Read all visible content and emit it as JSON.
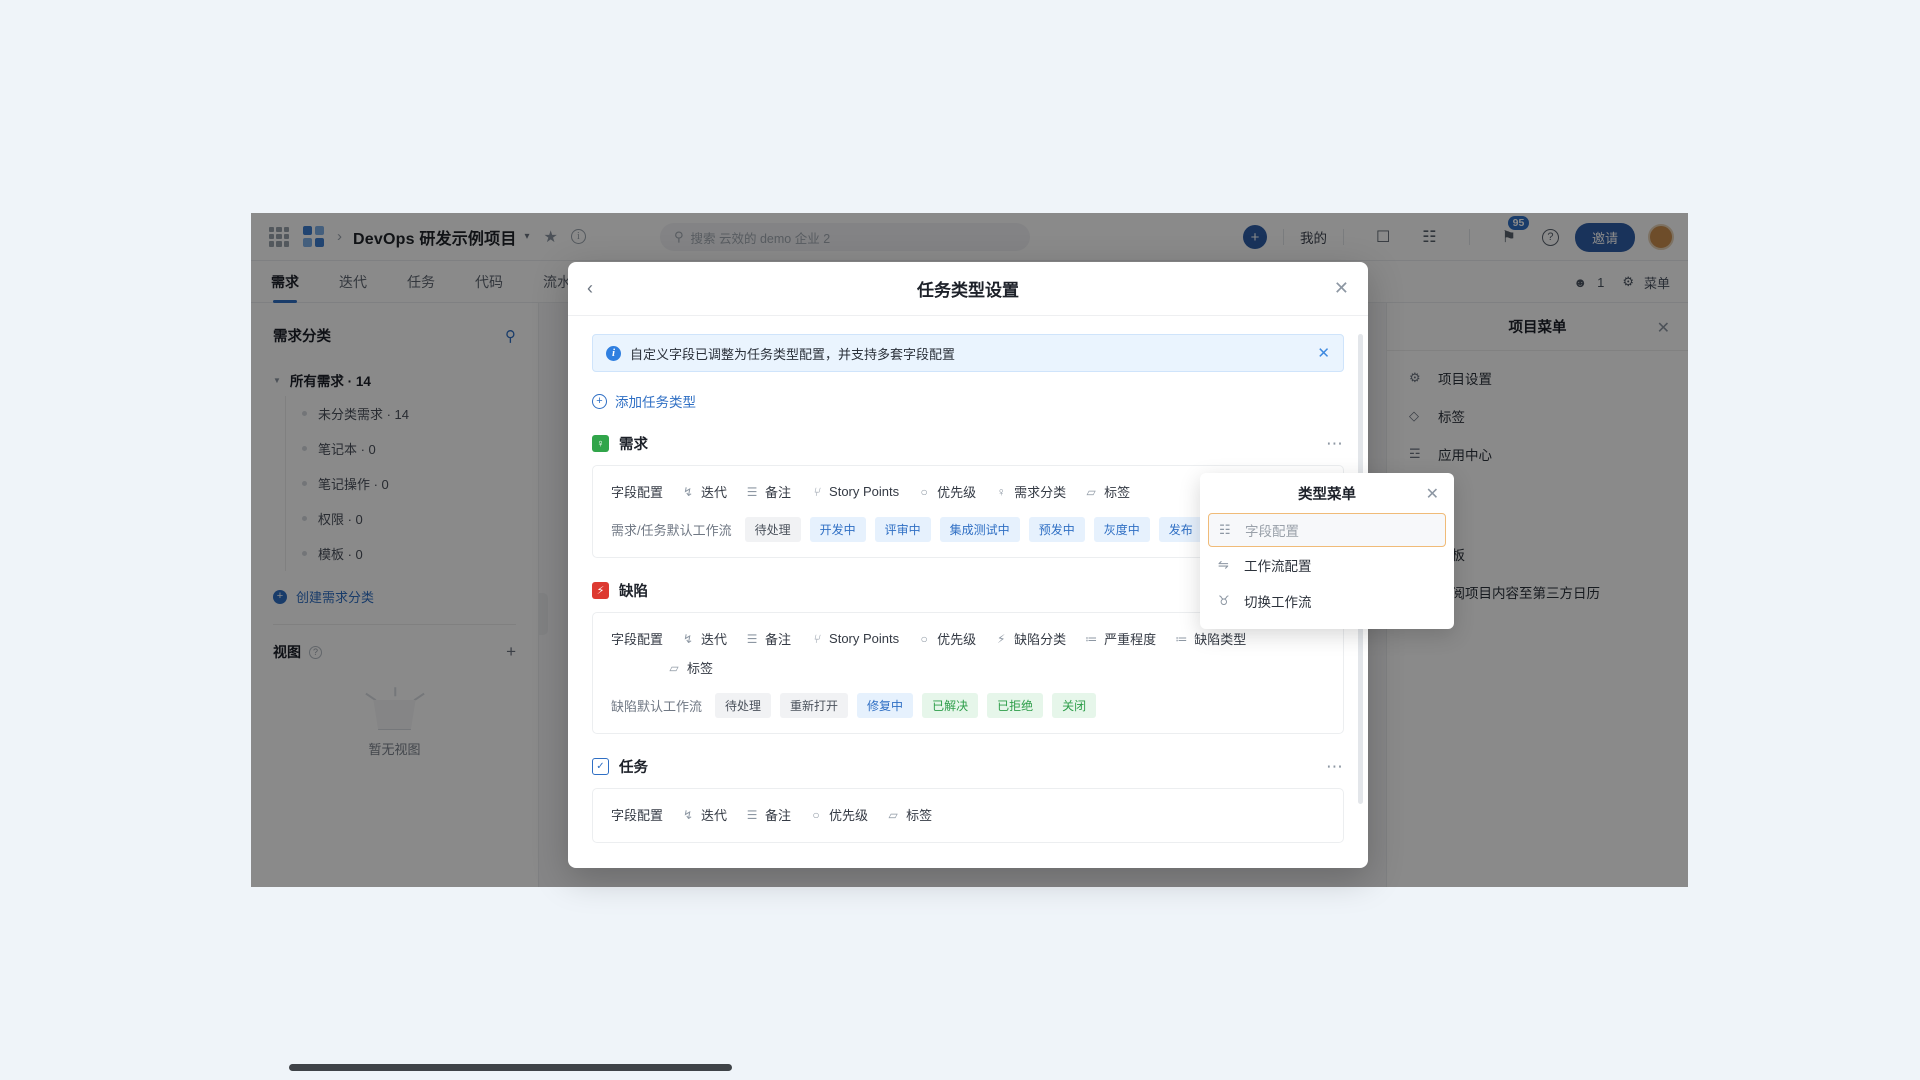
{
  "topbar": {
    "apps_icon": "grid-apps-icon",
    "workspace_icon": "workspace-logo-icon",
    "breadcrumb_sep": "›",
    "project_name": "DevOps 研发示例项目",
    "caret": "▾",
    "star_icon": "★",
    "info_icon": "i",
    "search_placeholder": "搜索 云效的 demo 企业 2",
    "search_icon": "⚲",
    "plus_label": "+",
    "mine_label": "我的",
    "calendar_icon": "☐",
    "message_icon": "☷",
    "bell_icon": "⚑",
    "bell_badge": "95",
    "help_icon": "?",
    "invite_label": "邀请",
    "avatar": "user-avatar"
  },
  "nav": {
    "tabs": [
      {
        "label": "需求",
        "active": true
      },
      {
        "label": "迭代",
        "active": false
      },
      {
        "label": "任务",
        "active": false
      },
      {
        "label": "代码",
        "active": false
      },
      {
        "label": "流水",
        "active": false
      }
    ],
    "member_icon": "☻",
    "member_count": "1",
    "menu_icon": "⚙",
    "menu_label": "菜单"
  },
  "left_sidebar": {
    "title": "需求分类",
    "search_icon": "search-icon",
    "root": {
      "label": "所有需求 · 14"
    },
    "children": [
      {
        "label": "未分类需求 · 14"
      },
      {
        "label": "笔记本 · 0"
      },
      {
        "label": "笔记操作 · 0"
      },
      {
        "label": "权限 · 0"
      },
      {
        "label": "模板 · 0"
      }
    ],
    "create_label": "创建需求分类",
    "view_title": "视图",
    "view_help": "?",
    "view_add": "+",
    "empty_text": "暂无视图"
  },
  "right_drawer": {
    "title": "项目菜单",
    "close": "✕",
    "items": [
      {
        "icon": "⚙",
        "label": "项目设置"
      },
      {
        "icon": "◇",
        "label": "标签"
      },
      {
        "icon": "☲",
        "label": "应用中心"
      },
      {
        "icon": "▤",
        "label": "模板"
      },
      {
        "icon": "☷",
        "label": "订阅项目内容至第三方日历"
      }
    ]
  },
  "modal": {
    "back_icon": "‹",
    "title": "任务类型设置",
    "close_icon": "✕",
    "alert": {
      "icon": "i",
      "text": "自定义字段已调整为任务类型配置，并支持多套字段配置",
      "close": "✕"
    },
    "add_type_label": "添加任务类型",
    "types": [
      {
        "name": "需求",
        "icon_kind": "req",
        "icon_glyph": "♀",
        "more": "⋯",
        "fields": [
          {
            "icon": "",
            "label": "字段配置"
          },
          {
            "icon": "↯",
            "label": "迭代"
          },
          {
            "icon": "☰",
            "label": "备注"
          },
          {
            "icon": "⑂",
            "label": "Story Points"
          },
          {
            "icon": "○",
            "label": "优先级"
          },
          {
            "icon": "♀",
            "label": "需求分类"
          },
          {
            "icon": "▱",
            "label": "标签"
          }
        ],
        "workflow_label": "需求/任务默认工作流",
        "workflow": [
          {
            "label": "待处理",
            "tone": "gray"
          },
          {
            "label": "开发中",
            "tone": "blue"
          },
          {
            "label": "评审中",
            "tone": "blue"
          },
          {
            "label": "集成测试中",
            "tone": "blue"
          },
          {
            "label": "预发中",
            "tone": "blue"
          },
          {
            "label": "灰度中",
            "tone": "blue"
          },
          {
            "label": "发布",
            "tone": "blue"
          }
        ]
      },
      {
        "name": "缺陷",
        "icon_kind": "bug",
        "icon_glyph": "⚡",
        "more": "⋯",
        "fields": [
          {
            "icon": "",
            "label": "字段配置"
          },
          {
            "icon": "↯",
            "label": "迭代"
          },
          {
            "icon": "☰",
            "label": "备注"
          },
          {
            "icon": "⑂",
            "label": "Story Points"
          },
          {
            "icon": "○",
            "label": "优先级"
          },
          {
            "icon": "⚡",
            "label": "缺陷分类"
          },
          {
            "icon": "≔",
            "label": "严重程度"
          },
          {
            "icon": "≔",
            "label": "缺陷类型"
          },
          {
            "icon": "▱",
            "label": "标签"
          }
        ],
        "workflow_label": "缺陷默认工作流",
        "workflow": [
          {
            "label": "待处理",
            "tone": "gray"
          },
          {
            "label": "重新打开",
            "tone": "gray"
          },
          {
            "label": "修复中",
            "tone": "blue"
          },
          {
            "label": "已解决",
            "tone": "green"
          },
          {
            "label": "已拒绝",
            "tone": "green"
          },
          {
            "label": "关闭",
            "tone": "green"
          }
        ]
      },
      {
        "name": "任务",
        "icon_kind": "task",
        "icon_glyph": "✓",
        "more": "⋯",
        "fields": [
          {
            "icon": "",
            "label": "字段配置"
          },
          {
            "icon": "↯",
            "label": "迭代"
          },
          {
            "icon": "☰",
            "label": "备注"
          },
          {
            "icon": "○",
            "label": "优先级"
          },
          {
            "icon": "▱",
            "label": "标签"
          }
        ],
        "workflow_label": "",
        "workflow": []
      }
    ]
  },
  "type_menu": {
    "title": "类型菜单",
    "close": "✕",
    "items": [
      {
        "icon": "☷",
        "label": "字段配置",
        "selected": true
      },
      {
        "icon": "⇋",
        "label": "工作流配置",
        "selected": false
      },
      {
        "icon": "♉",
        "label": "切换工作流",
        "selected": false
      }
    ]
  },
  "colors": {
    "page_bg": "#eff4f9",
    "accent_blue": "#2f6fc4",
    "req_green": "#31a54a",
    "bug_red": "#dd3a31",
    "highlight_orange": "#f0bb78"
  }
}
